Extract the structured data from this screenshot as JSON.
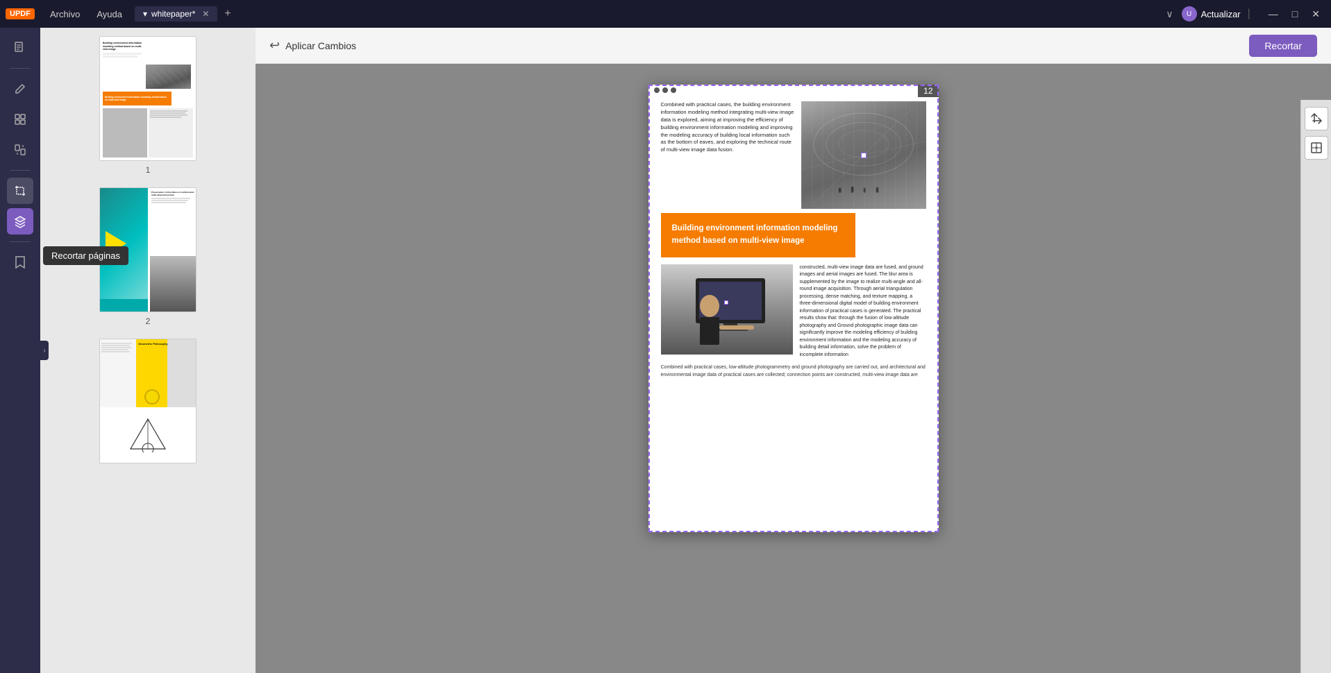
{
  "titlebar": {
    "logo": "UPDF",
    "menu_archivo": "Archivo",
    "menu_ayuda": "Ayuda",
    "tab_arrow": "▾",
    "tab_title": "whitepaper*",
    "tab_close": "✕",
    "tab_add": "+",
    "chevron": "∨",
    "user_label": "Actualizar",
    "minimize": "—",
    "maximize": "□",
    "close": "✕"
  },
  "toolbar": {
    "apply_label": "Aplicar Cambios",
    "recortar_label": "Recortar"
  },
  "tooltip": {
    "text": "Recortar páginas"
  },
  "thumbnails": [
    {
      "number": "1"
    },
    {
      "number": "2"
    },
    {
      "number": ""
    }
  ],
  "pdf_page": {
    "page_number": "12",
    "text_block": "Combined with practical cases, the building environment information modeling method integrating multi-view image data is explored, aiming at improving the efficiency of building environment information modeling and improving the modeling accuracy of building local information such as the bottom of eaves, and exploring the technical route of multi-view image data fusion.",
    "orange_banner": "Building environment information modeling method based on multi-view image",
    "bottom_right_text": "constructed, multi-view image data are fused, and ground images and aerial images are fused. The blur area is supplemented by the image to realize multi-angle and all-round image acquisition. Through aerial triangulation processing, dense matching, and texture mapping, a three-dimensional digital model of building environment information of practical cases is generated. The practical results show that: through the fusion of low-altitude photography and Ground photographic image data can significantly improve the modeling efficiency of building environment information and the modeling accuracy of building detail information, solve the problem of incomplete information",
    "bottom_left_text": "Combined with practical cases, low-altitude photogrammetry and ground photography are carried out, and architectural and environmental image data of practical cases are collected; connection points are constructed, multi-view image data are"
  },
  "page3_title": "Geometric Philosophy",
  "right_tools": [
    {
      "icon": "⊹",
      "label": "crop-tool-1"
    },
    {
      "icon": "⊡",
      "label": "crop-tool-2"
    }
  ],
  "left_tools": [
    {
      "icon": "📄",
      "label": "view-pages-tool"
    },
    {
      "icon": "✏️",
      "label": "edit-tool"
    },
    {
      "icon": "≡",
      "label": "organize-tool"
    },
    {
      "icon": "⊡",
      "label": "extract-tool"
    },
    {
      "icon": "⊕",
      "label": "convert-tool"
    },
    {
      "icon": "✂",
      "label": "crop-tool",
      "active": true
    },
    {
      "icon": "🔖",
      "label": "bookmark-tool"
    }
  ],
  "colors": {
    "orange": "#f57c00",
    "purple": "#7c5cbf",
    "dashed_border": "#9966ff",
    "toolbar_bg": "#2d2d4a",
    "page_bg": "white"
  }
}
